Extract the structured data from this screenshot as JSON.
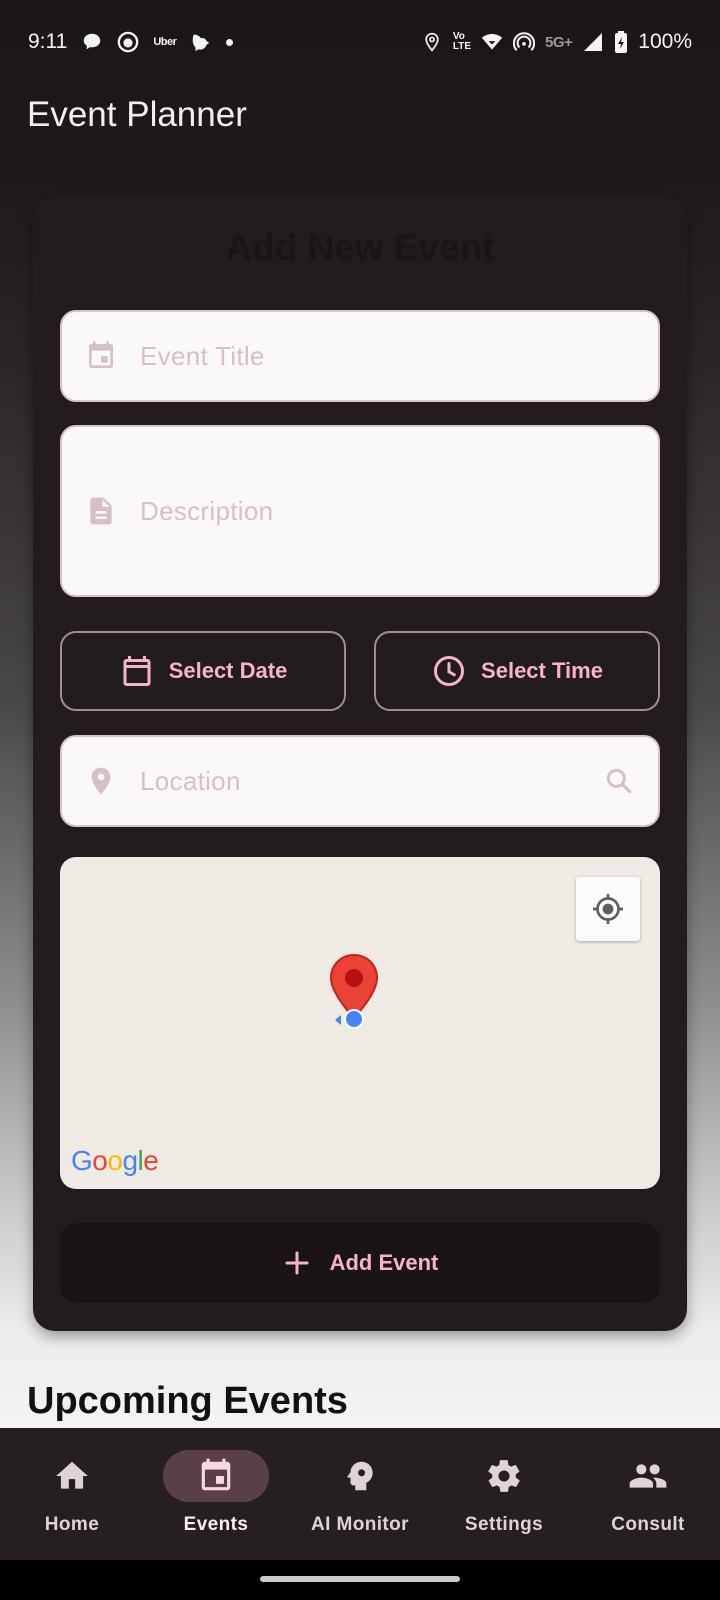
{
  "status_bar": {
    "time": "9:11",
    "left_icons": [
      "chat-bubble-icon",
      "face-icon",
      "uber-icon",
      "bird-icon"
    ],
    "uber_text": "Uber",
    "network_5g": "5G+",
    "volte_top": "Vo",
    "volte_bottom": "LTE",
    "battery": "100%"
  },
  "app_bar": {
    "title": "Event Planner"
  },
  "form": {
    "heading": "Add New Event",
    "title_placeholder": "Event Title",
    "description_placeholder": "Description",
    "select_date_label": "Select Date",
    "select_time_label": "Select Time",
    "location_placeholder": "Location",
    "map": {
      "attribution": "Google"
    },
    "add_button_label": "Add Event"
  },
  "section": {
    "upcoming_title": "Upcoming Events"
  },
  "bottom_nav": {
    "items": [
      {
        "label": "Home",
        "icon": "home-icon",
        "active": false
      },
      {
        "label": "Events",
        "icon": "event-icon",
        "active": true
      },
      {
        "label": "AI Monitor",
        "icon": "psychology-icon",
        "active": false
      },
      {
        "label": "Settings",
        "icon": "gear-icon",
        "active": false
      },
      {
        "label": "Consult",
        "icon": "people-icon",
        "active": false
      }
    ]
  },
  "colors": {
    "accent": "#f7b3cc",
    "card": "#231c1f",
    "nav_background": "#261f22",
    "active_pill": "#5b3f47"
  }
}
